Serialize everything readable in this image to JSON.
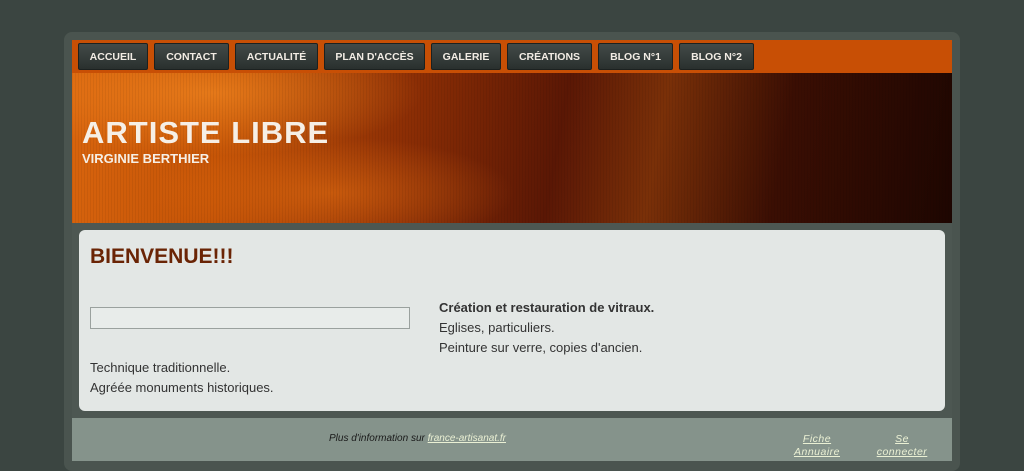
{
  "nav": {
    "items": [
      {
        "label": "ACCUEIL"
      },
      {
        "label": "CONTACT"
      },
      {
        "label": "ACTUALITÉ"
      },
      {
        "label": "PLAN D'ACCÈS"
      },
      {
        "label": "GALERIE"
      },
      {
        "label": "CRÉATIONS"
      },
      {
        "label": "BLOG N°1"
      },
      {
        "label": "BLOG N°2"
      }
    ]
  },
  "banner": {
    "title": "ARTISTE LIBRE",
    "subtitle": "VIRGINIE BERTHIER"
  },
  "content": {
    "heading": "BIENVENUE!!!",
    "left_lines": [
      "Technique traditionnelle.",
      "Agréée monuments historiques."
    ],
    "right_lines": [
      "Création et restauration de vitraux.",
      "Eglises, particuliers.",
      "Peinture sur verre, copies d'ancien."
    ]
  },
  "footer": {
    "info_text": "Plus d'information sur",
    "info_link": "france-artisanat.fr",
    "fiche_line1": "Fiche",
    "fiche_line2": "Annuaire",
    "connect_line1": "Se",
    "connect_line2": "connecter"
  },
  "colors": {
    "nav_bar": "#c84f05",
    "page_background": "#3b4541",
    "heading": "#6a2405",
    "footer": "#85938b"
  }
}
